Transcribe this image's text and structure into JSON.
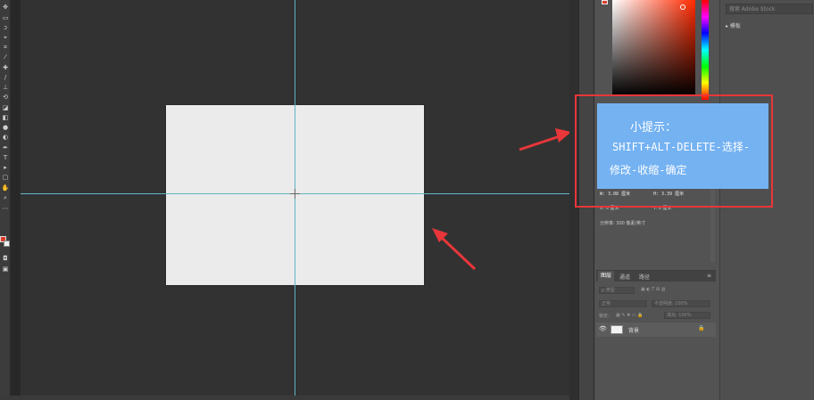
{
  "tooltip": {
    "title": "小提示：",
    "line1": "SHIFT+ALT-DELETE-选择-",
    "line2": "修改-收缩-确定"
  },
  "libraries": {
    "search_placeholder": "搜索 Adobe Stock",
    "item_label": "▸ 模板"
  },
  "properties": {
    "w_label": "W: 3.08 厘米",
    "h_label": "H: 3.39 厘米",
    "x_label": "X: 0 厘米",
    "y_label": "Y: 0 厘米",
    "resolution": "分辨率: 300 像素/英寸"
  },
  "layers": {
    "tabs": [
      "图层",
      "通道",
      "路径"
    ],
    "kind_filter": "ρ 类型",
    "blend_mode": "正常",
    "opacity_label": "不透明度: 100%",
    "lock_label": "锁定:",
    "fill_label": "填充: 100%",
    "background_layer": "背景"
  },
  "colors": {
    "foreground": "#e03a2a",
    "background": "#f2f2f2",
    "guide": "#5fb6c4",
    "annotation_red": "#e8363a",
    "tip_fill": "#74b2f2"
  }
}
